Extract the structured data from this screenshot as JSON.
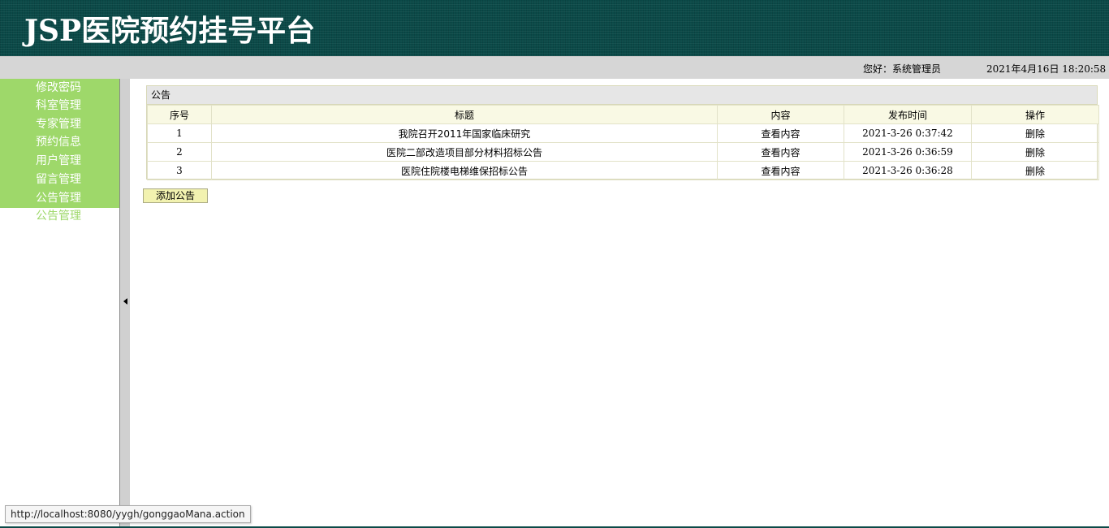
{
  "header": {
    "title": "JSP医院预约挂号平台"
  },
  "infobar": {
    "greeting": "您好：系统管理员",
    "datetime": "2021年4月16日 18:20:58"
  },
  "sidebar": {
    "items": [
      {
        "label": "修改密码"
      },
      {
        "label": "科室管理"
      },
      {
        "label": "专家管理"
      },
      {
        "label": "预约信息"
      },
      {
        "label": "用户管理"
      },
      {
        "label": "留言管理"
      },
      {
        "label": "公告管理"
      },
      {
        "label": "公告管理"
      }
    ]
  },
  "panel": {
    "title": "公告",
    "columns": [
      "序号",
      "标题",
      "内容",
      "发布时间",
      "操作"
    ],
    "rows": [
      {
        "index": "1",
        "title": "我院召开2011年国家临床研究",
        "content": "查看内容",
        "time": "2021-3-26 0:37:42",
        "action": "删除"
      },
      {
        "index": "2",
        "title": "医院二部改造项目部分材料招标公告",
        "content": "查看内容",
        "time": "2021-3-26 0:36:59",
        "action": "删除"
      },
      {
        "index": "3",
        "title": "医院住院楼电梯维保招标公告",
        "content": "查看内容",
        "time": "2021-3-26 0:36:28",
        "action": "删除"
      }
    ]
  },
  "add_button": {
    "label": "添加公告"
  },
  "status_bar": {
    "url": "http://localhost:8080/yygh/gonggaoMana.action"
  },
  "colors": {
    "header_bg": "#0b4a48",
    "menu_bg": "#9ed86a",
    "infobar_bg": "#d6d6d6",
    "table_header_bg": "#f9f9e4",
    "button_bg": "#f2f2b0"
  }
}
